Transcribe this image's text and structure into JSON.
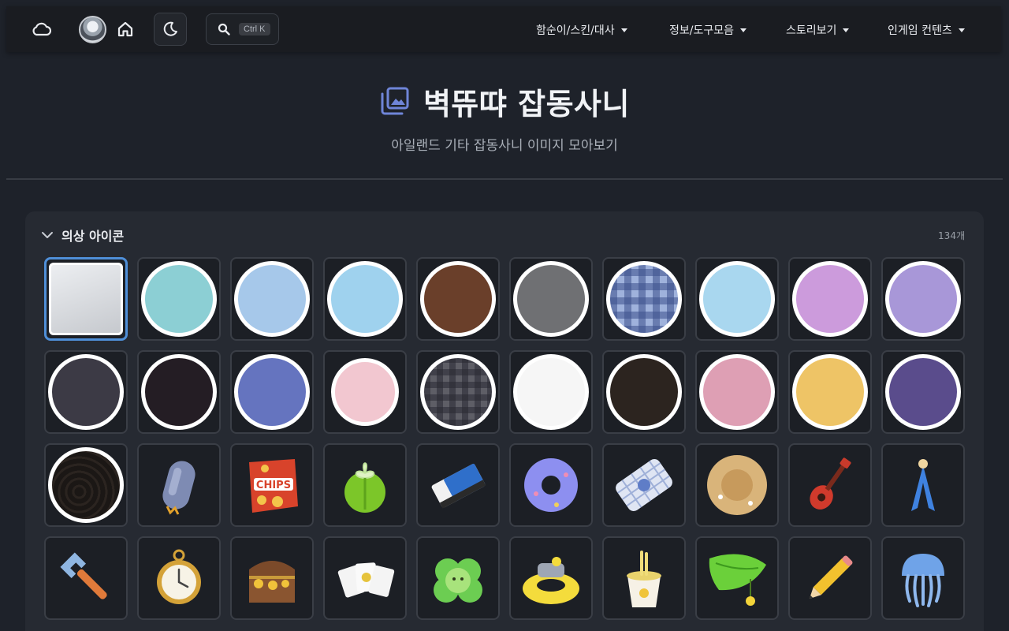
{
  "nav": {
    "search_shortcut": "Ctrl K",
    "menus": [
      "함순이/스킨/대사",
      "정보/도구모음",
      "스토리보기",
      "인게임 컨텐츠"
    ]
  },
  "header": {
    "title": "벽뜌땨 잡동사니",
    "subtitle": "아일랜드 기타 잡동사니 이미지 모아보기"
  },
  "section": {
    "title": "의상 아이콘",
    "count": "134개"
  },
  "colors": {
    "accent": "#6f85d8",
    "selected_border": "#4f8fd8"
  },
  "icons": {
    "row1": [
      "white-square",
      "teal",
      "light-blue",
      "sky-blue",
      "brown",
      "gray",
      "blue-plaid",
      "pale-sky-blue",
      "orchid",
      "lavender"
    ],
    "row2": [
      "charcoal",
      "black",
      "periwinkle",
      "light-pink",
      "gray-plaid",
      "white",
      "dark-brown",
      "rose-pink",
      "mustard",
      "indigo"
    ],
    "row3": [
      "black-wave-pattern",
      "gray-capsule-item",
      "chips-bag-item",
      "lettuce-item",
      "eraser-item",
      "donut-float-item",
      "pillow-item",
      "straw-hat-item",
      "ukulele-item",
      "ribbon-item"
    ],
    "row4": [
      "wrench-item",
      "pocket-watch-item",
      "treasure-chest-item",
      "playing-cards-item",
      "cabbage-plush-item",
      "tube-float-item",
      "noodle-cup-item",
      "leaf-umbrella-item",
      "pencil-item",
      "jellyfish-item"
    ]
  }
}
